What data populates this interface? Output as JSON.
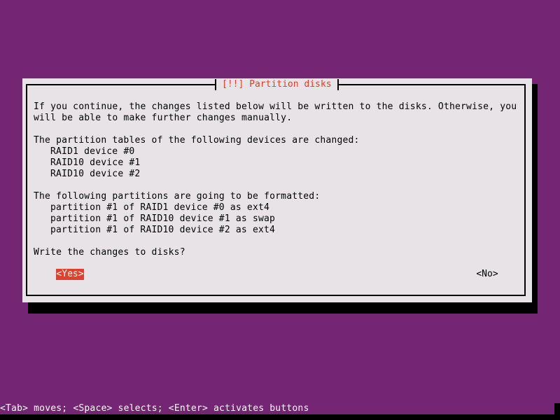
{
  "dialog": {
    "title": "[!!] Partition disks",
    "intro_lines": [
      "If you continue, the changes listed below will be written to the disks. Otherwise, you",
      "will be able to make further changes manually."
    ],
    "tables_heading": "The partition tables of the following devices are changed:",
    "devices": [
      "RAID1 device #0",
      "RAID10 device #1",
      "RAID10 device #2"
    ],
    "format_heading": "The following partitions are going to be formatted:",
    "partitions": [
      "partition #1 of RAID1 device #0 as ext4",
      "partition #1 of RAID10 device #1 as swap",
      "partition #1 of RAID10 device #2 as ext4"
    ],
    "question": "Write the changes to disks?",
    "buttons": {
      "yes": "<Yes>",
      "no": "<No>",
      "selected": "yes"
    }
  },
  "status_bar": "<Tab> moves; <Space> selects; <Enter> activates buttons",
  "colors": {
    "background": "#742573",
    "dialog": "#e7e3e6",
    "accent": "#e0402e",
    "shadow": "#000000"
  }
}
